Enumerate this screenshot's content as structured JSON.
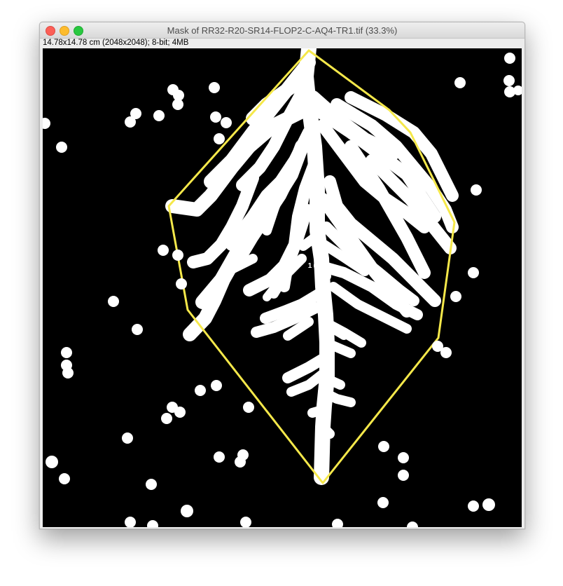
{
  "window": {
    "title": "Mask of RR32-R20-SR14-FLOP2-C-AQ4-TR1.tif (33.3%)",
    "info": "14.78x14.78 cm (2048x2048); 8-bit; 4MB",
    "controls": [
      "close",
      "minimize",
      "zoom"
    ]
  },
  "image": {
    "roi_label": "1",
    "background_color": "#000000",
    "foreground_color": "#ffffff",
    "roi_color": "#f5e84a"
  }
}
